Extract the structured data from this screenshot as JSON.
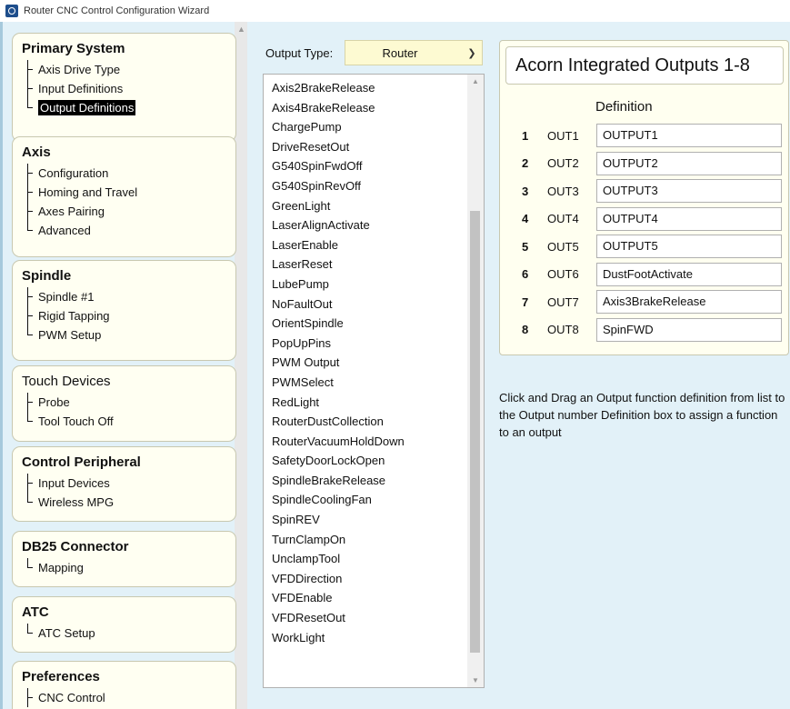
{
  "window": {
    "title": "Router CNC Control Configuration Wizard"
  },
  "sidebar": {
    "sections": [
      {
        "title": "Primary System",
        "items": [
          "Axis Drive Type",
          "Input Definitions",
          "Output Definitions"
        ],
        "selected": "Output Definitions"
      },
      {
        "title": "Axis",
        "items": [
          "Configuration",
          "Homing and Travel",
          "Axes Pairing",
          "Advanced"
        ]
      },
      {
        "title": "Spindle",
        "items": [
          "Spindle #1",
          "Rigid Tapping",
          "PWM Setup"
        ]
      },
      {
        "title": "Touch Devices",
        "items": [
          "Probe",
          "Tool Touch Off"
        ]
      },
      {
        "title": "Control Peripheral",
        "items": [
          "Input Devices",
          "Wireless MPG"
        ]
      },
      {
        "title": "DB25 Connector",
        "items": [
          "Mapping"
        ]
      },
      {
        "title": "ATC",
        "items": [
          "ATC Setup"
        ]
      },
      {
        "title": "Preferences",
        "items": [
          "CNC Control"
        ]
      }
    ]
  },
  "main": {
    "output_type_label": "Output Type:",
    "output_type_value": "Router",
    "functions": [
      "Axis2BrakeRelease",
      "Axis4BrakeRelease",
      "ChargePump",
      "DriveResetOut",
      "G540SpinFwdOff",
      "G540SpinRevOff",
      "GreenLight",
      "LaserAlignActivate",
      "LaserEnable",
      "LaserReset",
      "LubePump",
      "NoFaultOut",
      "OrientSpindle",
      "PopUpPins",
      "PWM Output",
      "PWMSelect",
      "RedLight",
      "RouterDustCollection",
      "RouterVacuumHoldDown",
      "SafetyDoorLockOpen",
      "SpindleBrakeRelease",
      "SpindleCoolingFan",
      "SpinREV",
      "TurnClampOn",
      "UnclampTool",
      "VFDDirection",
      "VFDEnable",
      "VFDResetOut",
      "WorkLight"
    ],
    "outputs_title": "Acorn Integrated Outputs 1-8",
    "definition_header": "Definition",
    "outputs": [
      {
        "num": "1",
        "name": "OUT1",
        "definition": "OUTPUT1"
      },
      {
        "num": "2",
        "name": "OUT2",
        "definition": "OUTPUT2"
      },
      {
        "num": "3",
        "name": "OUT3",
        "definition": "OUTPUT3"
      },
      {
        "num": "4",
        "name": "OUT4",
        "definition": "OUTPUT4"
      },
      {
        "num": "5",
        "name": "OUT5",
        "definition": "OUTPUT5"
      },
      {
        "num": "6",
        "name": "OUT6",
        "definition": "DustFootActivate"
      },
      {
        "num": "7",
        "name": "OUT7",
        "definition": "Axis3BrakeRelease"
      },
      {
        "num": "8",
        "name": "OUT8",
        "definition": "SpinFWD"
      }
    ],
    "hint": "Click and Drag an Output function definition from list to the Output number Definition box to assign a function to an output"
  },
  "colors": {
    "panel_bg": "#e2f1f8",
    "card_bg": "#fffff2",
    "select_bg": "#fdfad2"
  }
}
